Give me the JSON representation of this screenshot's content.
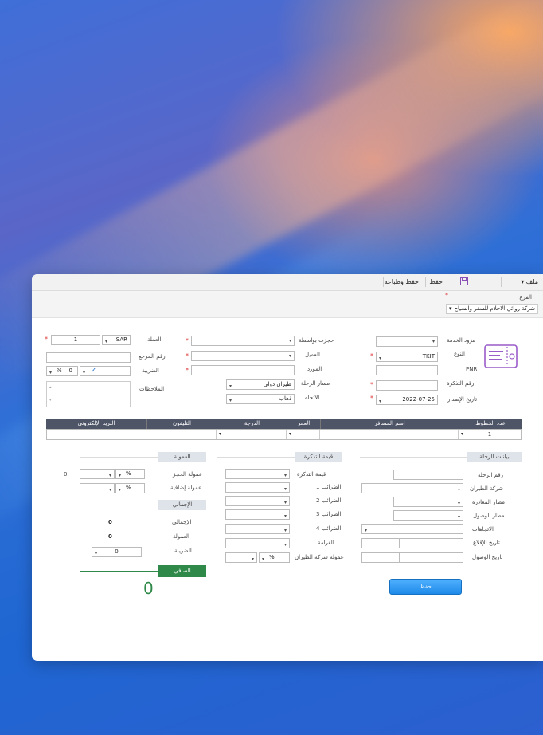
{
  "toolbar": {
    "file_label": "ملف",
    "save_label": "حفظ",
    "save_print_label": "حفظ وطباعة"
  },
  "branch": {
    "label": "الفرع",
    "value": "شركة روائي الاحلام للسفر والسياح"
  },
  "form": {
    "supplier_label": "مزود الخدمة",
    "type_label": "النوع",
    "type_value": "TKIT",
    "pnr_label": "PNR",
    "ticket_no_label": "رقم التذكرة",
    "issue_date_label": "تاريخ الإصدار",
    "issue_date_value": "2022-07-25",
    "booked_by_label": "حجزت بواسطة",
    "client_label": "العميل",
    "resource_label": "المورد",
    "route_label": "مسار الرحلة",
    "route_value": "طيران دولي",
    "direction_label": "الاتجاه",
    "direction_value": "ذهاب",
    "currency_label": "العملة",
    "currency_value": "SAR",
    "rate_value": "1",
    "ref_label": "رقم المرجع",
    "tax_label": "الضريبة",
    "tax_value": "0",
    "tax_unit": "%",
    "notes_label": "الملاحظات"
  },
  "table": {
    "headers": [
      "عدد الخطوط",
      "اسم المسافر",
      "العمر",
      "الدرجة",
      "التليفون",
      "البريد الإلكتروني"
    ],
    "row": {
      "lines": "1"
    }
  },
  "trip": {
    "header": "بيانات الرحلة",
    "flight_no": "رقم الرحلة",
    "airline": "شركة الطيران",
    "departure_airport": "مطار المغادرة",
    "arrival_airport": "مطار الوصول",
    "directions": "الاتجاهات",
    "takeoff_date": "تاريخ الإقلاع",
    "arrival_date": "تاريخ الوصول"
  },
  "ticket_value": {
    "header": "قيمة التذكرة",
    "ticket_price": "قيمة التذكرة",
    "tax1": "الضرائب 1",
    "tax2": "الضرائب 2",
    "tax3": "الضرائب 3",
    "tax4": "الضرائب 4",
    "penalty": "الغرامة",
    "airline_commission": "عمولة شركة الطيران",
    "pct": "%"
  },
  "commission": {
    "header": "العمولة",
    "booking": "عمولة الحجز",
    "extra": "عمولة إضافية",
    "pct": "%",
    "side_value": "0"
  },
  "totals": {
    "header": "الإجمالي",
    "total_label": "الإجمالي",
    "total_value": "0",
    "commission_label": "العمولة",
    "commission_value": "0",
    "tax_label": "الضريبة",
    "tax_value": "0",
    "net_label": "الصافي",
    "net_value": "0"
  },
  "save_button": "حفظ",
  "colors": {
    "accent_blue": "#1f8ae8",
    "net_green": "#2f8a4a",
    "header_dark": "#4e5567"
  }
}
